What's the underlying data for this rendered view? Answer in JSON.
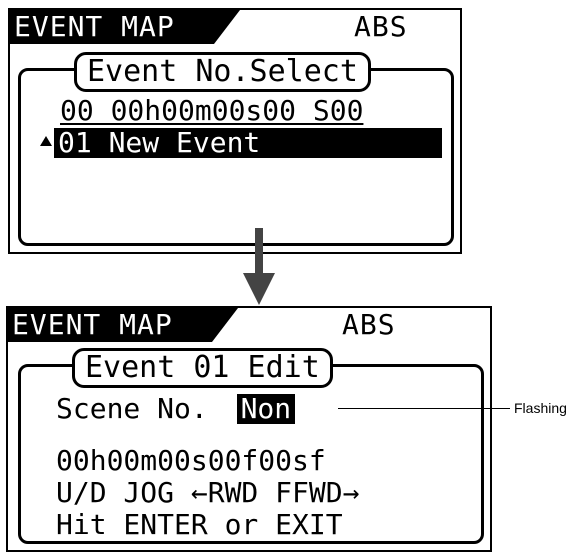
{
  "screen1": {
    "header_label": "EVENT MAP",
    "mode_label": "ABS",
    "title": "Event No.Select",
    "row_1": "00 00h00m00s00 S00",
    "selected_row": "01 New Event"
  },
  "screen2": {
    "header_label": "EVENT MAP",
    "mode_label": "ABS",
    "title": "Event 01 Edit",
    "scene_label": "Scene No.",
    "scene_value": "Non",
    "time_line": "00h00m00s00f00sf",
    "hint_line1": "U/D JOG ←RWD FFWD→",
    "hint_line2": "Hit ENTER or EXIT"
  },
  "callout": {
    "label": "Flashing"
  }
}
